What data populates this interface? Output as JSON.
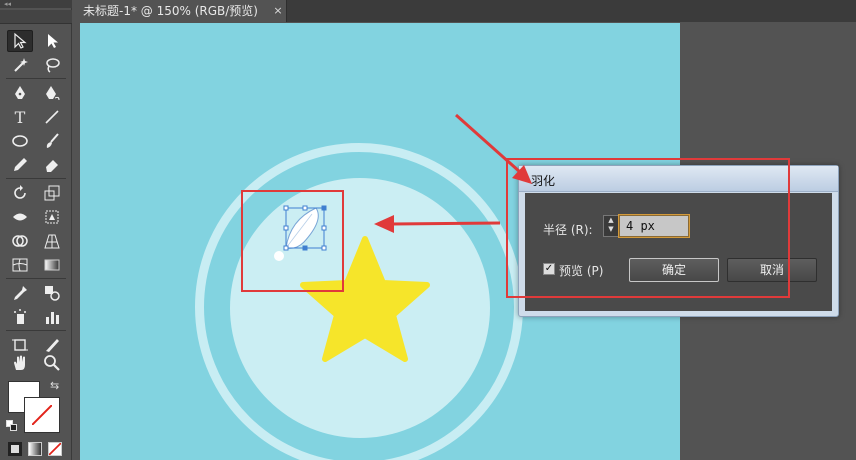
{
  "document": {
    "tab_title": "未标题-1* @ 150% (RGB/预览)",
    "tab_close": "×"
  },
  "toolbar": {
    "grip_label": "◂◂",
    "tools": [
      "selection-tool",
      "direct-selection-tool",
      "magic-wand-tool",
      "lasso-tool",
      "pen-tool",
      "curvature-pen-tool",
      "type-tool",
      "line-segment-tool",
      "ellipse-tool",
      "paintbrush-tool",
      "pencil-tool",
      "eraser-tool",
      "rotate-tool",
      "scale-tool",
      "width-tool",
      "free-transform-tool",
      "shape-builder-tool",
      "perspective-grid-tool",
      "mesh-tool",
      "gradient-tool",
      "eyedropper-tool",
      "blend-tool",
      "symbol-sprayer-tool",
      "column-graph-tool",
      "artboard-tool",
      "slice-tool",
      "hand-tool",
      "zoom-tool"
    ],
    "type_glyph": "T",
    "swap_glyph": "⇆"
  },
  "colors": {
    "artboard": "#82d3e0",
    "ring": "#c8edf3",
    "disc": "#cbeef3",
    "star": "#f6e52a",
    "annotation": "#e03a3a"
  },
  "dialog": {
    "title": "羽化",
    "radius_label": "半径 (R):",
    "radius_value": "4 px",
    "stepper_up": "▲",
    "stepper_down": "▼",
    "preview_checked": "✓",
    "preview_label": "预览 (P)",
    "ok_label": "确定",
    "cancel_label": "取消"
  }
}
